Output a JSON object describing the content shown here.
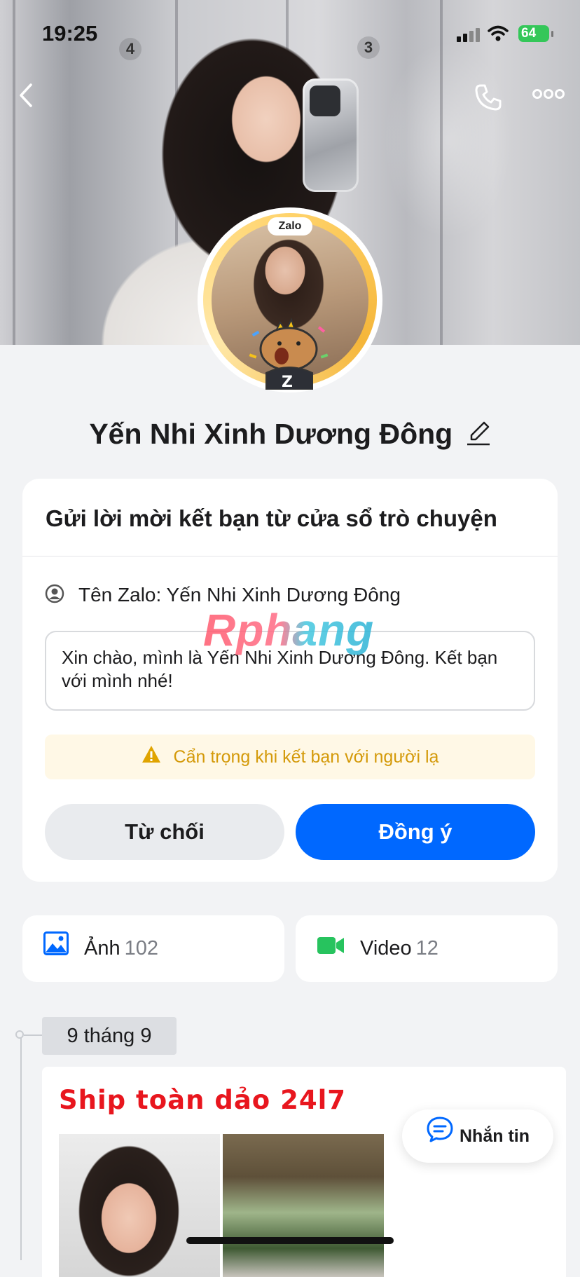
{
  "status_bar": {
    "time": "19:25",
    "battery": "64"
  },
  "cover": {
    "door_numbers": [
      "4",
      "3"
    ]
  },
  "avatar": {
    "badge": "Zalo"
  },
  "profile": {
    "name": "Yến Nhi Xinh Dương Đông"
  },
  "friend_request": {
    "title": "Gửi lời mời kết bạn từ cửa sổ trò chuyện",
    "zalo_name": "Tên Zalo: Yến Nhi Xinh Dương Đông",
    "message": "Xin chào, mình là Yến Nhi Xinh Dương Đông. Kết bạn với mình nhé!",
    "warning": "Cẩn trọng khi kết bạn với người lạ",
    "reject_label": "Từ chối",
    "accept_label": "Đồng ý"
  },
  "watermark": "Rphang",
  "media": {
    "photo_label": "Ảnh",
    "photo_count": "102",
    "video_label": "Video",
    "video_count": "12"
  },
  "timeline": {
    "date": "9 tháng 9",
    "post_title": "Ship toàn dảo 24l7"
  },
  "chat_button": {
    "label": "Nhắn tin"
  },
  "colors": {
    "accent": "#0068ff",
    "warning": "#d49a0a",
    "post_title": "#e8161e",
    "video_icon": "#27c35e"
  }
}
